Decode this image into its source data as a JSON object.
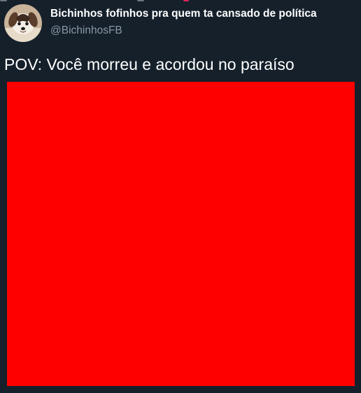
{
  "tweet": {
    "author": {
      "display_name": "Bichinhos fofinhos pra quem ta cansado de política",
      "handle": "@BichinhosFB",
      "avatar_icon": "puppy-avatar-icon"
    },
    "text": "POV: Você morreu e acordou no paraíso",
    "media": {
      "kind": "image",
      "fill_color": "#ff0000"
    }
  },
  "theme": {
    "background": "#15202b",
    "text_primary": "#ffffff",
    "text_secondary": "#8899a6"
  }
}
